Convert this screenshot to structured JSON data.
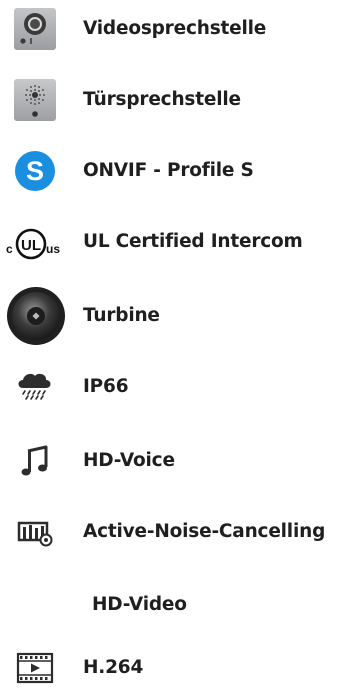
{
  "features": [
    {
      "label": "Videosprechstelle",
      "icon": "video-door-station-icon"
    },
    {
      "label": "Türsprechstelle",
      "icon": "audio-door-station-icon"
    },
    {
      "label": "ONVIF - Profile S",
      "icon": "onvif-s-icon"
    },
    {
      "label": "UL Certified Intercom",
      "icon": "ul-certified-icon"
    },
    {
      "label": "Turbine",
      "icon": "turbine-icon"
    },
    {
      "label": "IP66",
      "icon": "rain-cloud-icon"
    },
    {
      "label": "HD-Voice",
      "icon": "music-note-icon"
    },
    {
      "label": "Active-Noise-Cancelling",
      "icon": "noise-cancelling-icon"
    },
    {
      "label": "HD-Video",
      "icon": ""
    },
    {
      "label": "H.264",
      "icon": "video-film-icon"
    }
  ],
  "colors": {
    "text": "#1f1f1f",
    "panel_gray": "#a9aaac",
    "onvif_blue": "#1a8fe0",
    "icon_dark": "#2d2d2d"
  }
}
